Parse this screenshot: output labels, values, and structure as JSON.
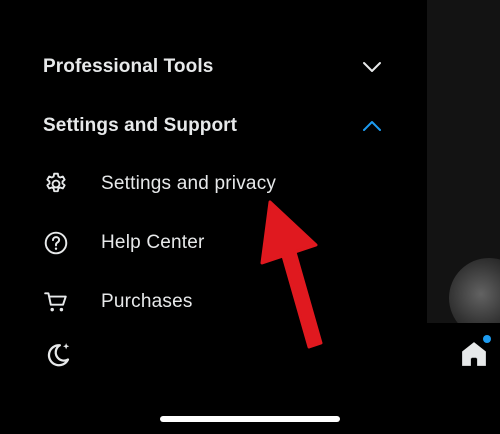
{
  "drawer": {
    "sections": [
      {
        "label": "Professional Tools",
        "expanded": false
      },
      {
        "label": "Settings and Support",
        "expanded": true
      }
    ],
    "items": [
      {
        "label": "Settings and privacy",
        "icon": "gear-icon"
      },
      {
        "label": "Help Center",
        "icon": "help-circle-icon"
      },
      {
        "label": "Purchases",
        "icon": "cart-icon"
      }
    ],
    "display_toggle_icon": "moon-sparkle-icon"
  },
  "tabbar": {
    "home_icon": "home-icon",
    "notification_dot": true
  },
  "colors": {
    "background": "#000000",
    "text": "#e7e9ea",
    "accent": "#1d9bf0",
    "annotation_arrow": "#e0191f"
  }
}
